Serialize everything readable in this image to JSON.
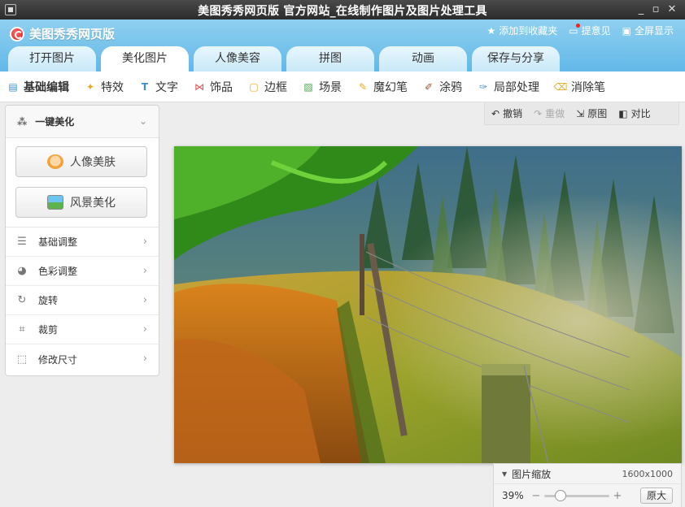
{
  "window": {
    "title": "美图秀秀网页版 官方网站_在线制作图片及图片处理工具",
    "controls": [
      "minimize-icon",
      "maximize-icon",
      "close-icon"
    ]
  },
  "header": {
    "logo_text": "美图秀秀网页版",
    "links": [
      {
        "icon": "star-icon",
        "label": "添加到收藏夹"
      },
      {
        "icon": "feedback-icon",
        "label": "提意见"
      },
      {
        "icon": "fullscreen-icon",
        "label": "全屏显示"
      }
    ],
    "tabs": [
      {
        "label": "打开图片",
        "active": false
      },
      {
        "label": "美化图片",
        "active": true
      },
      {
        "label": "人像美容",
        "active": false
      },
      {
        "label": "拼图",
        "active": false
      },
      {
        "label": "动画",
        "active": false
      },
      {
        "label": "保存与分享",
        "active": false
      }
    ]
  },
  "toolbar": {
    "items": [
      {
        "icon": "basic-edit-icon",
        "label": "基础编辑",
        "active": true
      },
      {
        "icon": "effects-icon",
        "label": "特效"
      },
      {
        "icon": "text-icon",
        "label": "文字"
      },
      {
        "icon": "decoration-icon",
        "label": "饰品"
      },
      {
        "icon": "frame-icon",
        "label": "边框"
      },
      {
        "icon": "scene-icon",
        "label": "场景"
      },
      {
        "icon": "magic-pen-icon",
        "label": "魔幻笔"
      },
      {
        "icon": "graffiti-icon",
        "label": "涂鸦"
      },
      {
        "icon": "local-process-icon",
        "label": "局部处理"
      },
      {
        "icon": "eraser-icon",
        "label": "消除笔"
      }
    ]
  },
  "left_panel": {
    "onekey_label": "一键美化",
    "buttons": [
      {
        "icon": "portrait-icon",
        "label": "人像美肤"
      },
      {
        "icon": "landscape-icon",
        "label": "风景美化"
      }
    ],
    "menu": [
      {
        "icon": "sliders-icon",
        "label": "基础调整"
      },
      {
        "icon": "palette-icon",
        "label": "色彩调整"
      },
      {
        "icon": "rotate-icon",
        "label": "旋转"
      },
      {
        "icon": "crop-icon",
        "label": "裁剪"
      },
      {
        "icon": "resize-icon",
        "label": "修改尺寸"
      }
    ]
  },
  "actions": [
    {
      "icon": "undo-icon",
      "label": "撤销",
      "enabled": true
    },
    {
      "icon": "redo-icon",
      "label": "重做",
      "enabled": false
    },
    {
      "icon": "original-icon",
      "label": "原图",
      "enabled": true
    },
    {
      "icon": "compare-icon",
      "label": "对比",
      "enabled": true
    }
  ],
  "zoom": {
    "title": "图片缩放",
    "image_size": "1600x1000",
    "percent": "39%",
    "level_fraction": 0.2,
    "original_button": "原大"
  },
  "colors": {
    "header_blue": "#62b8e8",
    "tab_active": "#ffffff",
    "title_bar": "#2b2b2b"
  }
}
